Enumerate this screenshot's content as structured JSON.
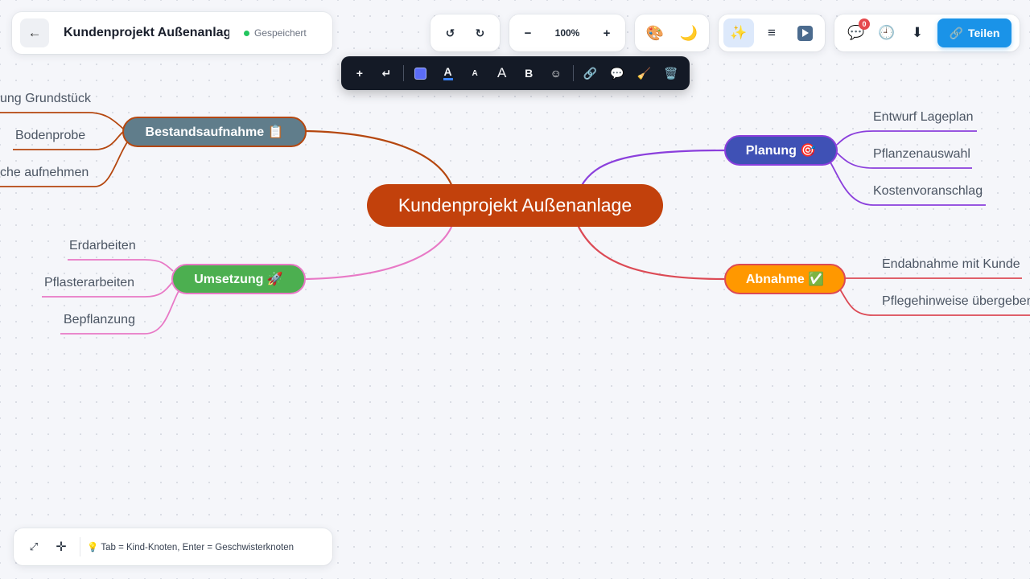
{
  "header": {
    "back_icon": "←",
    "title": "Kundenprojekt Außenanlage",
    "save_status": "Gespeichert",
    "save_status_color": "#22c55e"
  },
  "toolbar": {
    "undo_icon": "↺",
    "redo_icon": "↻",
    "zoom_out_label": "−",
    "zoom_level": "100%",
    "zoom_in_label": "+",
    "theme_palette_icon": "🎨",
    "dark_mode_icon": "🌙",
    "magic_icon": "✨",
    "outline_icon": "≡",
    "comments_icon": "💬",
    "comments_count": "0",
    "history_icon": "🕘",
    "download_icon": "⬇",
    "share_icon": "🔗",
    "share_label": "Teilen",
    "accent_color": "#1a93e8"
  },
  "format_toolbar": {
    "add_child_icon": "+",
    "add_sibling_icon": "↵",
    "text_color_icon": "A",
    "font_smaller_icon": "A",
    "font_larger_icon": "A",
    "bold_icon": "B",
    "emoji_icon": "☺",
    "link_icon": "🔗",
    "comment_icon": "💬",
    "clear_format_icon": "🧹",
    "delete_icon": "🗑️"
  },
  "mindmap": {
    "root": {
      "label": "Kundenprojekt Außenanlage",
      "color": "#c2410c"
    },
    "branches": [
      {
        "label": "Bestandsaufnahme 📋",
        "color": "#607d8b",
        "edge_color": "#b5470f",
        "children": [
          "ung Grundstück",
          "Bodenprobe",
          "che aufnehmen"
        ]
      },
      {
        "label": "Umsetzung 🚀",
        "color": "#4caf50",
        "edge_color": "#e879c6",
        "children": [
          "Erdarbeiten",
          "Pflasterarbeiten",
          "Bepflanzung"
        ]
      },
      {
        "label": "Planung 🎯",
        "color": "#3f51b5",
        "edge_color": "#8b3fdc",
        "children": [
          "Entwurf Lageplan",
          "Pflanzenauswahl",
          "Kostenvoranschlag"
        ]
      },
      {
        "label": "Abnahme ✅",
        "color": "#ff9800",
        "edge_color": "#dc4a55",
        "children": [
          "Endabnahme mit Kunde",
          "Pflegehinweise übergeben"
        ]
      }
    ]
  },
  "footer": {
    "fit_icon": "⤢",
    "center_icon": "✛",
    "hint_icon": "💡",
    "hint_text": "Tab = Kind-Knoten, Enter = Geschwisterknoten"
  }
}
